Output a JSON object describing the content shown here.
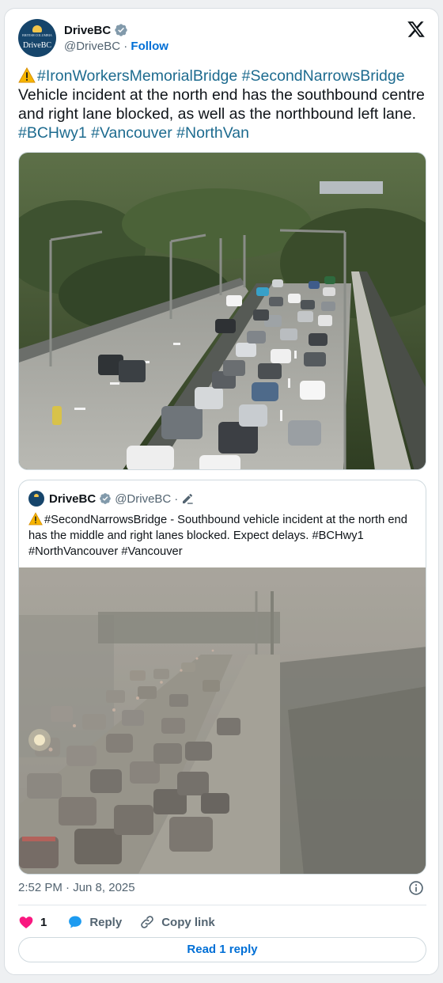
{
  "author": {
    "name": "DriveBC",
    "handle": "@DriveBC",
    "separator": "·",
    "follow_label": "Follow",
    "avatar_small_text": "BRITISH COLUMBIA",
    "avatar_logo_text": "DriveBC"
  },
  "tweet": {
    "tag_bridge1": "#IronWorkersMemorialBridge",
    "tag_bridge2": "#SecondNarrowsBridge",
    "body": "Vehicle incident at the north end has the southbound centre and right lane blocked, as well as the northbound left lane.",
    "tags_end": [
      "#BCHwy1",
      "#Vancouver",
      "#NorthVan"
    ]
  },
  "quote": {
    "name": "DriveBC",
    "handle": "@DriveBC",
    "separator": "·",
    "tag_bridge": "#SecondNarrowsBridge",
    "body": " - Southbound vehicle incident at the north end has the middle and right lanes blocked. Expect delays. ",
    "tags_end": [
      "#BCHwy1",
      "#NorthVancouver",
      "#Vancouver"
    ]
  },
  "meta": {
    "timestamp": "2:52 PM · Jun 8, 2025"
  },
  "actions": {
    "like_count": "1",
    "reply_label": "Reply",
    "copy_link_label": "Copy link",
    "read_replies_label": "Read 1 reply"
  },
  "colors": {
    "hashtag": "#1d6b8f",
    "follow": "#006fd6",
    "like_heart": "#f91880",
    "verified": "#829aab"
  },
  "icons": [
    "verified-icon",
    "x-logo-icon",
    "warning-icon",
    "edit-icon",
    "info-icon",
    "heart-icon",
    "reply-bubble-icon",
    "link-icon"
  ]
}
